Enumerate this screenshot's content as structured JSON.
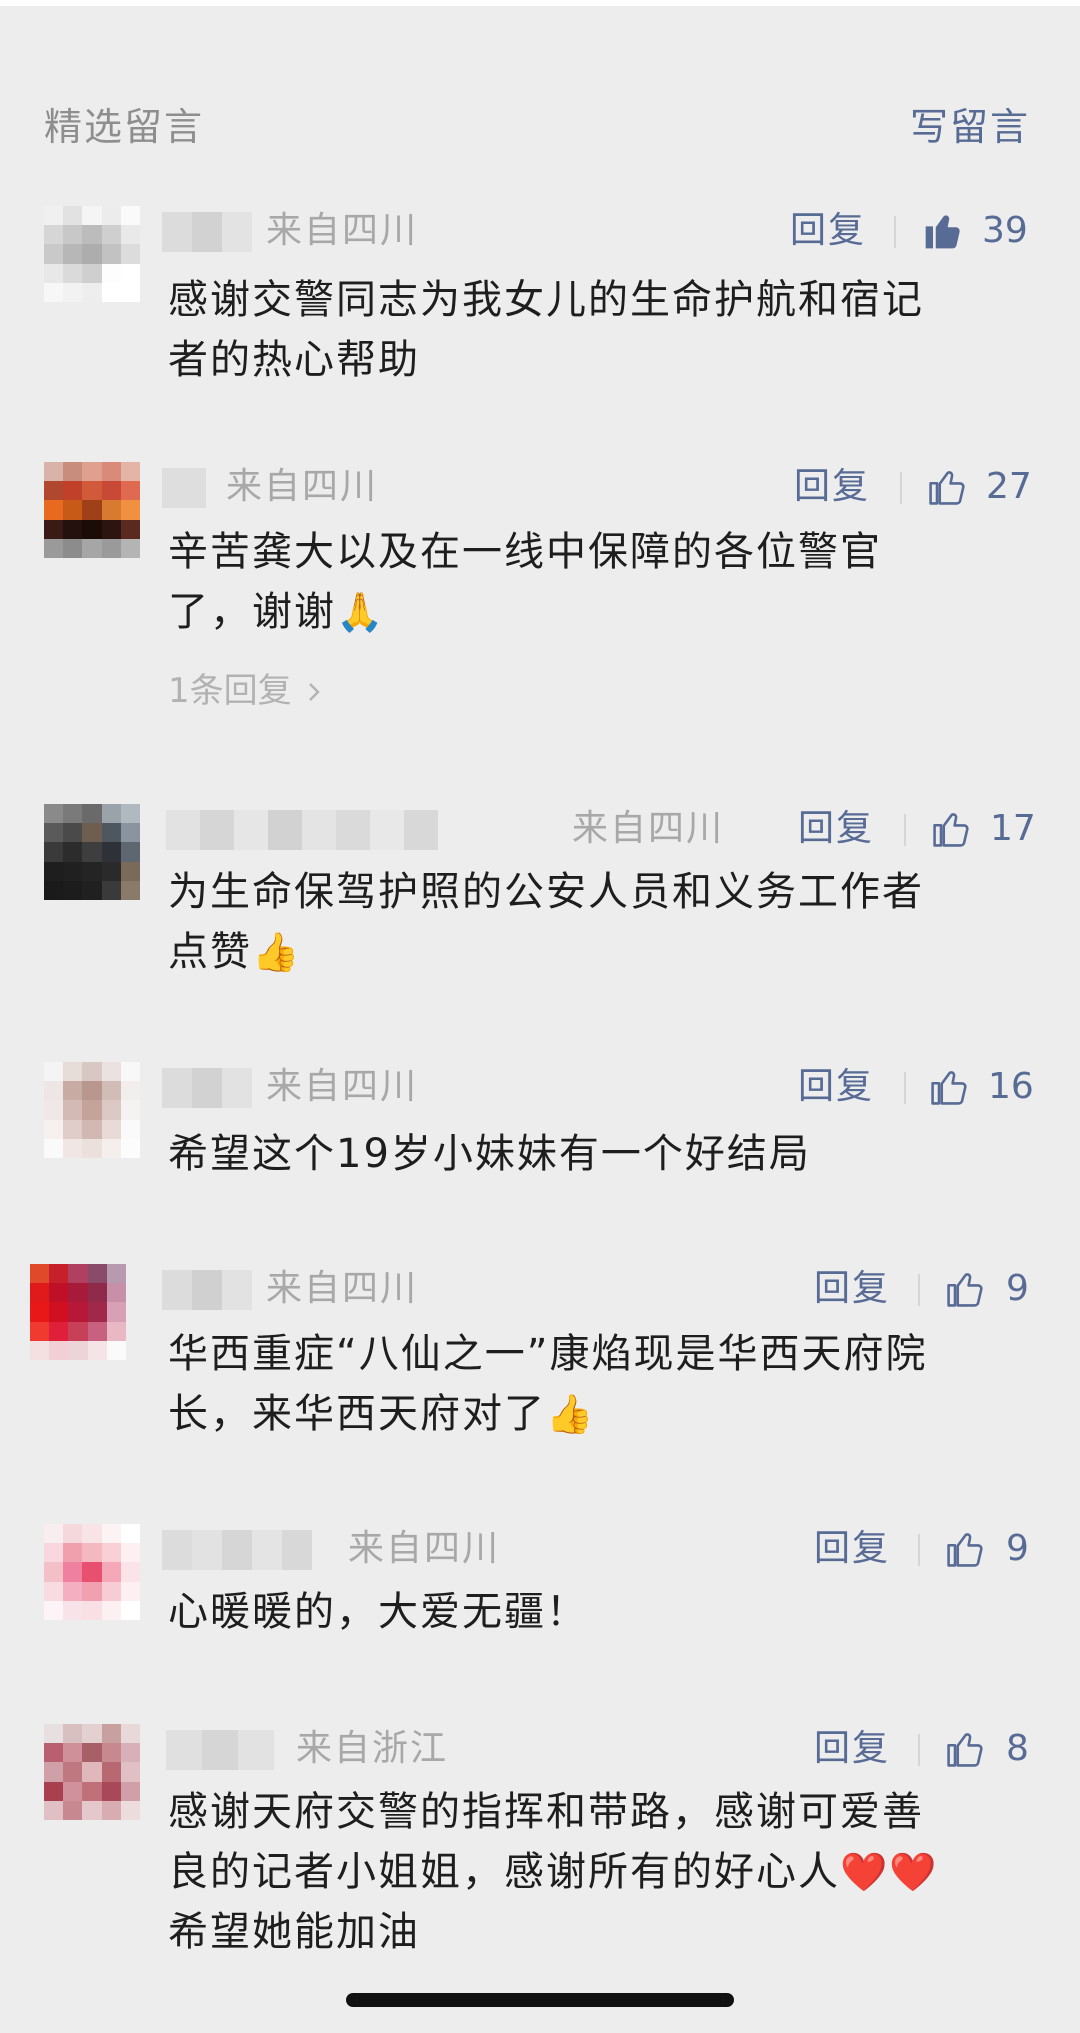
{
  "header": {
    "title": "精选留言",
    "write_label": "写留言"
  },
  "reply_label": "回复",
  "comments": [
    {
      "origin": "来自四川",
      "likes": "39",
      "liked": true,
      "text_lines": [
        "感谢交警同志为我女儿的生命护航和宿记",
        "者的热心帮助"
      ]
    },
    {
      "origin": "来自四川",
      "likes": "27",
      "liked": false,
      "text_lines": [
        "辛苦龚大以及在一线中保障的各位警官",
        "了，谢谢"
      ],
      "emoji": "🙏",
      "sub_replies": "1条回复"
    },
    {
      "origin": "来自四川",
      "likes": "17",
      "liked": false,
      "text_lines": [
        "为生命保驾护照的公安人员和义务工作者",
        "点赞"
      ],
      "emoji": "👍"
    },
    {
      "origin": "来自四川",
      "likes": "16",
      "liked": false,
      "text_lines": [
        "希望这个19岁小妹妹有一个好结局"
      ]
    },
    {
      "origin": "来自四川",
      "likes": "9",
      "liked": false,
      "text_lines": [
        "华西重症“八仙之一”康焰现是华西天府院",
        "长，来华西天府对了"
      ],
      "emoji": "👍"
    },
    {
      "origin": "来自四川",
      "likes": "9",
      "liked": false,
      "text_lines": [
        "心暖暖的，大爱无疆！"
      ]
    },
    {
      "origin": "来自浙江",
      "likes": "8",
      "liked": false,
      "text_lines": [
        "感谢天府交警的指挥和带路，感谢可爱善",
        "良的记者小姐姐，感谢所有的好心人",
        "希望她能加油"
      ],
      "emoji": "❤️❤️"
    }
  ],
  "colors": {
    "link": "#576b95",
    "muted": "#a8a8a8",
    "text": "#1e1e1e",
    "background": "#ededed"
  },
  "icons": {
    "like": "thumbs-up-icon",
    "more": "chevron-right-icon"
  }
}
